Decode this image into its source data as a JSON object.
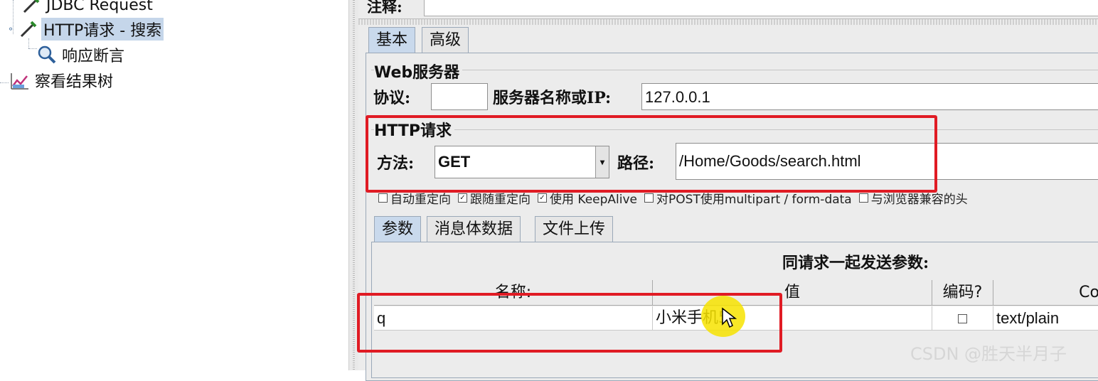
{
  "tree": {
    "items": [
      {
        "label": "JDBC Request",
        "icon": "pipette-icon",
        "selected": false
      },
      {
        "label": "HTTP请求 - 搜索",
        "icon": "pipette-icon",
        "selected": true
      },
      {
        "label": "响应断言",
        "icon": "magnifier-icon",
        "selected": false
      },
      {
        "label": "察看结果树",
        "icon": "graph-icon",
        "selected": false
      }
    ]
  },
  "comment": {
    "label": "注释:",
    "value": ""
  },
  "main_tabs": [
    {
      "label": "基本",
      "active": true
    },
    {
      "label": "高级",
      "active": false
    }
  ],
  "web_server": {
    "title": "Web服务器",
    "protocol_label": "协议:",
    "protocol_value": "",
    "server_label": "服务器名称或IP:",
    "server_value": "127.0.0.1"
  },
  "http_request": {
    "title": "HTTP请求",
    "method_label": "方法:",
    "method_value": "GET",
    "path_label": "路径:",
    "path_value": "/Home/Goods/search.html"
  },
  "options": [
    {
      "label": "自动重定向",
      "checked": false
    },
    {
      "label": "跟随重定向",
      "checked": true
    },
    {
      "label": "使用 KeepAlive",
      "checked": true
    },
    {
      "label": "对POST使用multipart / form-data",
      "checked": false
    },
    {
      "label": "与浏览器兼容的头",
      "checked": false
    }
  ],
  "param_tabs": [
    {
      "label": "参数",
      "active": true
    },
    {
      "label": "消息体数据",
      "active": false
    },
    {
      "label": "文件上传",
      "active": false
    }
  ],
  "params_table": {
    "caption": "同请求一起发送参数:",
    "columns": [
      "名称:",
      "值",
      "编码?",
      "Co"
    ],
    "rows": [
      {
        "name": "q",
        "value": "小米手机5",
        "encode": false,
        "content_type": "text/plain"
      }
    ]
  },
  "watermark": "CSDN @胜天半月子",
  "colors": {
    "highlight": "#e01b24",
    "selection": "#c5d6ea",
    "cursor_halo": "#f7e300"
  }
}
